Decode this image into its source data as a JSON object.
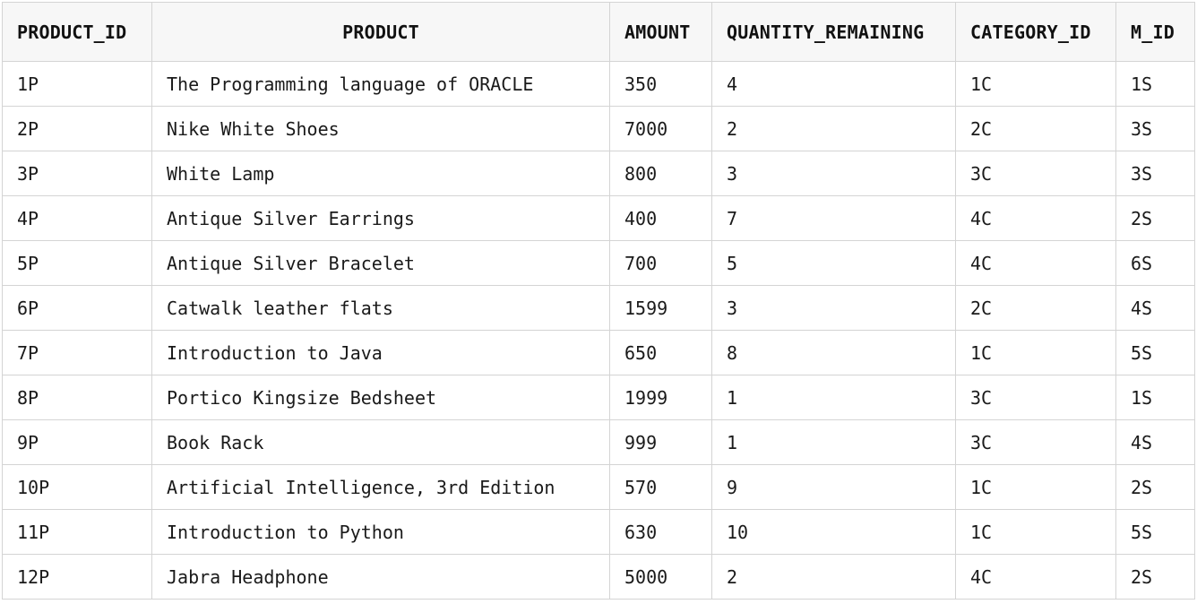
{
  "table": {
    "columns": [
      "PRODUCT_ID",
      "PRODUCT",
      "AMOUNT",
      "QUANTITY_REMAINING",
      "CATEGORY_ID",
      "M_ID"
    ],
    "rows": [
      [
        "1P",
        "The Programming language of ORACLE",
        "350",
        "4",
        "1C",
        "1S"
      ],
      [
        "2P",
        "Nike White Shoes",
        "7000",
        "2",
        "2C",
        "3S"
      ],
      [
        "3P",
        "White Lamp",
        "800",
        "3",
        "3C",
        "3S"
      ],
      [
        "4P",
        "Antique Silver Earrings",
        "400",
        "7",
        "4C",
        "2S"
      ],
      [
        "5P",
        "Antique Silver Bracelet",
        "700",
        "5",
        "4C",
        "6S"
      ],
      [
        "6P",
        "Catwalk leather flats",
        "1599",
        "3",
        "2C",
        "4S"
      ],
      [
        "7P",
        "Introduction to Java",
        "650",
        "8",
        "1C",
        "5S"
      ],
      [
        "8P",
        "Portico Kingsize Bedsheet",
        "1999",
        "1",
        "3C",
        "1S"
      ],
      [
        "9P",
        "Book Rack",
        "999",
        "1",
        "3C",
        "4S"
      ],
      [
        "10P",
        "Artificial Intelligence, 3rd Edition",
        "570",
        "9",
        "1C",
        "2S"
      ],
      [
        "11P",
        "Introduction to Python",
        "630",
        "10",
        "1C",
        "5S"
      ],
      [
        "12P",
        "Jabra Headphone",
        "5000",
        "2",
        "4C",
        "2S"
      ]
    ]
  }
}
